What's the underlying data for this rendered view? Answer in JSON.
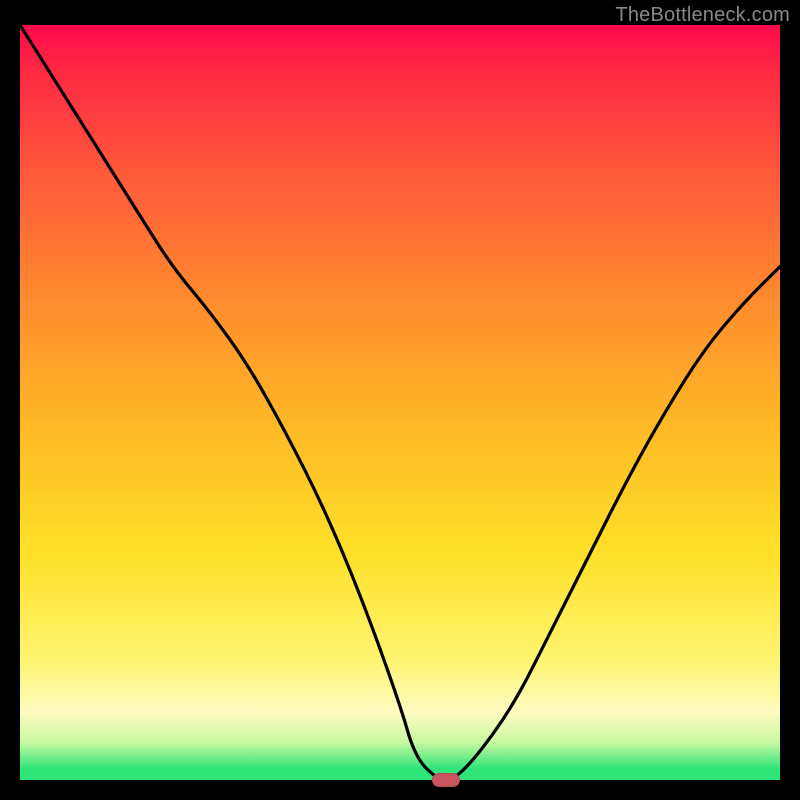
{
  "watermark": "TheBottleneck.com",
  "colors": {
    "curve_stroke": "#000000",
    "marker_fill": "#c9545e",
    "frame_bg": "#000000"
  },
  "chart_data": {
    "type": "line",
    "title": "",
    "xlabel": "",
    "ylabel": "",
    "xlim": [
      0,
      100
    ],
    "ylim": [
      0,
      100
    ],
    "grid": false,
    "legend": false,
    "series": [
      {
        "name": "bottleneck-curve",
        "x": [
          0,
          5,
          10,
          15,
          20,
          25,
          30,
          35,
          40,
          45,
          50,
          52,
          55,
          57,
          60,
          65,
          70,
          75,
          80,
          85,
          90,
          95,
          100
        ],
        "y": [
          100,
          92,
          84,
          76,
          68,
          62,
          55,
          46,
          36,
          24,
          10,
          3,
          0,
          0,
          3,
          10,
          20,
          30,
          40,
          49,
          57,
          63,
          68
        ]
      }
    ],
    "marker": {
      "name": "optimum-marker",
      "x": 56,
      "y": 0
    },
    "background_gradient_stops": [
      {
        "pos": 0.0,
        "color": "#ff0a4a"
      },
      {
        "pos": 0.2,
        "color": "#ff5a3a"
      },
      {
        "pos": 0.52,
        "color": "#ffb626"
      },
      {
        "pos": 0.84,
        "color": "#fff570"
      },
      {
        "pos": 0.95,
        "color": "#c8f8a0"
      },
      {
        "pos": 1.0,
        "color": "#2fe57a"
      }
    ]
  }
}
